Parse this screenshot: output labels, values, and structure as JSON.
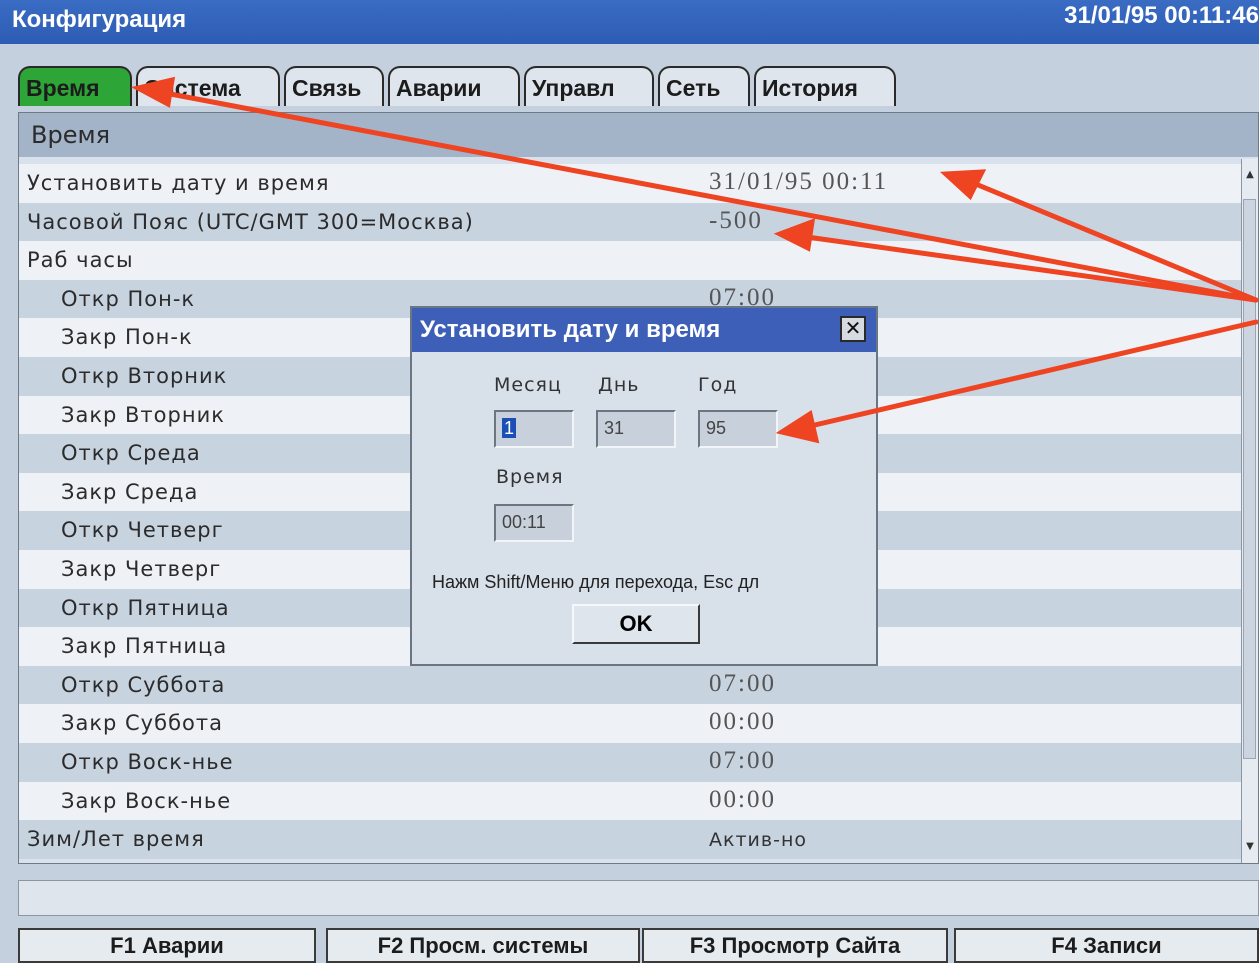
{
  "window": {
    "title": "Конфигурация",
    "clock": "31/01/95 00:11:46"
  },
  "tabs": [
    {
      "label": "Время",
      "active": true
    },
    {
      "label": "Система"
    },
    {
      "label": "Связь"
    },
    {
      "label": "Аварии"
    },
    {
      "label": "Управл"
    },
    {
      "label": "Сеть"
    },
    {
      "label": "История"
    }
  ],
  "panel": {
    "header": "Время",
    "rows": [
      {
        "label": "Установить дату и время",
        "value": "31/01/95 00:11",
        "indent": 0
      },
      {
        "label": "Часовой Пояс (UTC/GMT 300=Москва)",
        "value": "-500",
        "indent": 0
      },
      {
        "label": "Раб часы",
        "value": "",
        "indent": 0
      },
      {
        "label": "Откр  Пон-к",
        "value": "07:00",
        "indent": 1
      },
      {
        "label": "Закр Пон-к",
        "value": "",
        "indent": 1
      },
      {
        "label": "Откр  Вторник",
        "value": "",
        "indent": 1
      },
      {
        "label": "Закр Вторник",
        "value": "",
        "indent": 1
      },
      {
        "label": "Откр  Среда",
        "value": "",
        "indent": 1
      },
      {
        "label": "Закр Среда",
        "value": "",
        "indent": 1
      },
      {
        "label": "Откр  Четверг",
        "value": "",
        "indent": 1
      },
      {
        "label": "Закр Четверг",
        "value": "",
        "indent": 1
      },
      {
        "label": "Откр  Пятница",
        "value": "",
        "indent": 1
      },
      {
        "label": "Закр Пятница",
        "value": "",
        "indent": 1
      },
      {
        "label": "Откр  Суббота",
        "value": "07:00",
        "indent": 1
      },
      {
        "label": "Закр Суббота",
        "value": "00:00",
        "indent": 1
      },
      {
        "label": "Откр  Воск-нье",
        "value": "07:00",
        "indent": 1
      },
      {
        "label": "Закр Воск-нье",
        "value": "00:00",
        "indent": 1
      },
      {
        "label": "Зим/Лет время",
        "value": "Актив-но",
        "indent": 0,
        "small": true
      }
    ]
  },
  "dialog": {
    "title": "Установить дату и время",
    "close": "✕",
    "month_label": "Месяц",
    "day_label": "Днь",
    "year_label": "Год",
    "month_value": "1",
    "day_value": "31",
    "year_value": "95",
    "time_label": "Время",
    "time_value": "00:11",
    "hint": "Нажм Shift/Меню для перехода, Esc дл",
    "ok": "OK"
  },
  "status": {
    "text": ""
  },
  "function_keys": [
    {
      "label": "F1 Аварии"
    },
    {
      "label": "F2 Просм. системы"
    },
    {
      "label": "F3 Просмотр Сайта"
    },
    {
      "label": "F4 Записи"
    }
  ],
  "colors": {
    "active_tab": "#2ea537",
    "title_bar": "#2d5cb3",
    "dialog_title": "#3d5fb8",
    "annotation_arrow": "#ee4422"
  }
}
